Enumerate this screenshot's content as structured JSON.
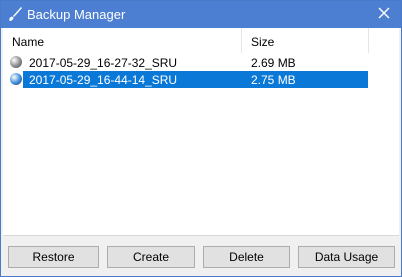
{
  "window": {
    "title": "Backup Manager",
    "accent_color": "#4c7fd1",
    "app_icon": "paintbrush-icon",
    "close_icon": "close-icon"
  },
  "list": {
    "columns": {
      "name": "Name",
      "size": "Size"
    },
    "selection_color": "#0a78d7",
    "rows": [
      {
        "name": "2017-05-29_16-27-32_SRU",
        "size": "2.69 MB",
        "selected": false,
        "bullet_color": "#8a8a8a"
      },
      {
        "name": "2017-05-29_16-44-14_SRU",
        "size": "2.75 MB",
        "selected": true,
        "bullet_color": "#3a8ad8"
      }
    ]
  },
  "buttons": {
    "restore": "Restore",
    "create": "Create",
    "delete": "Delete",
    "data_usage": "Data Usage"
  }
}
